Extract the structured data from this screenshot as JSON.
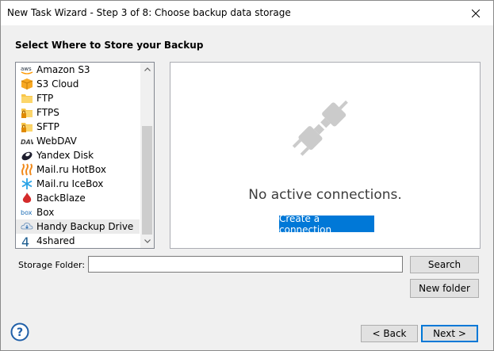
{
  "window": {
    "title": "New Task Wizard - Step 3 of 8: Choose backup data storage"
  },
  "heading": "Select Where to Store your Backup",
  "storage_list": [
    {
      "label": "Amazon S3",
      "icon": "aws-icon"
    },
    {
      "label": "S3 Cloud",
      "icon": "s3-cloud-icon"
    },
    {
      "label": "FTP",
      "icon": "ftp-folder-icon"
    },
    {
      "label": "FTPS",
      "icon": "ftps-folder-icon"
    },
    {
      "label": "SFTP",
      "icon": "sftp-folder-icon"
    },
    {
      "label": "WebDAV",
      "icon": "webdav-icon"
    },
    {
      "label": "Yandex Disk",
      "icon": "yandex-disk-icon"
    },
    {
      "label": "Mail.ru HotBox",
      "icon": "mailru-hotbox-icon"
    },
    {
      "label": "Mail.ru IceBox",
      "icon": "mailru-icebox-icon"
    },
    {
      "label": "BackBlaze",
      "icon": "backblaze-icon"
    },
    {
      "label": "Box",
      "icon": "box-icon"
    },
    {
      "label": "Handy Backup Drive",
      "icon": "handy-backup-drive-icon"
    },
    {
      "label": "4shared",
      "icon": "4shared-icon"
    }
  ],
  "icon_texts": {
    "aws": "aws",
    "box": "box",
    "dav": "DAV",
    "fourshared": "4"
  },
  "panel": {
    "message": "No active connections.",
    "create_button": "Create a connection"
  },
  "storage_folder": {
    "label": "Storage Folder:",
    "value": ""
  },
  "buttons": {
    "search": "Search",
    "new_folder": "New folder",
    "back": "< Back",
    "next": "Next >",
    "help": "?"
  },
  "colors": {
    "accent": "#0078d7",
    "window_bg": "#f0f0f0"
  }
}
